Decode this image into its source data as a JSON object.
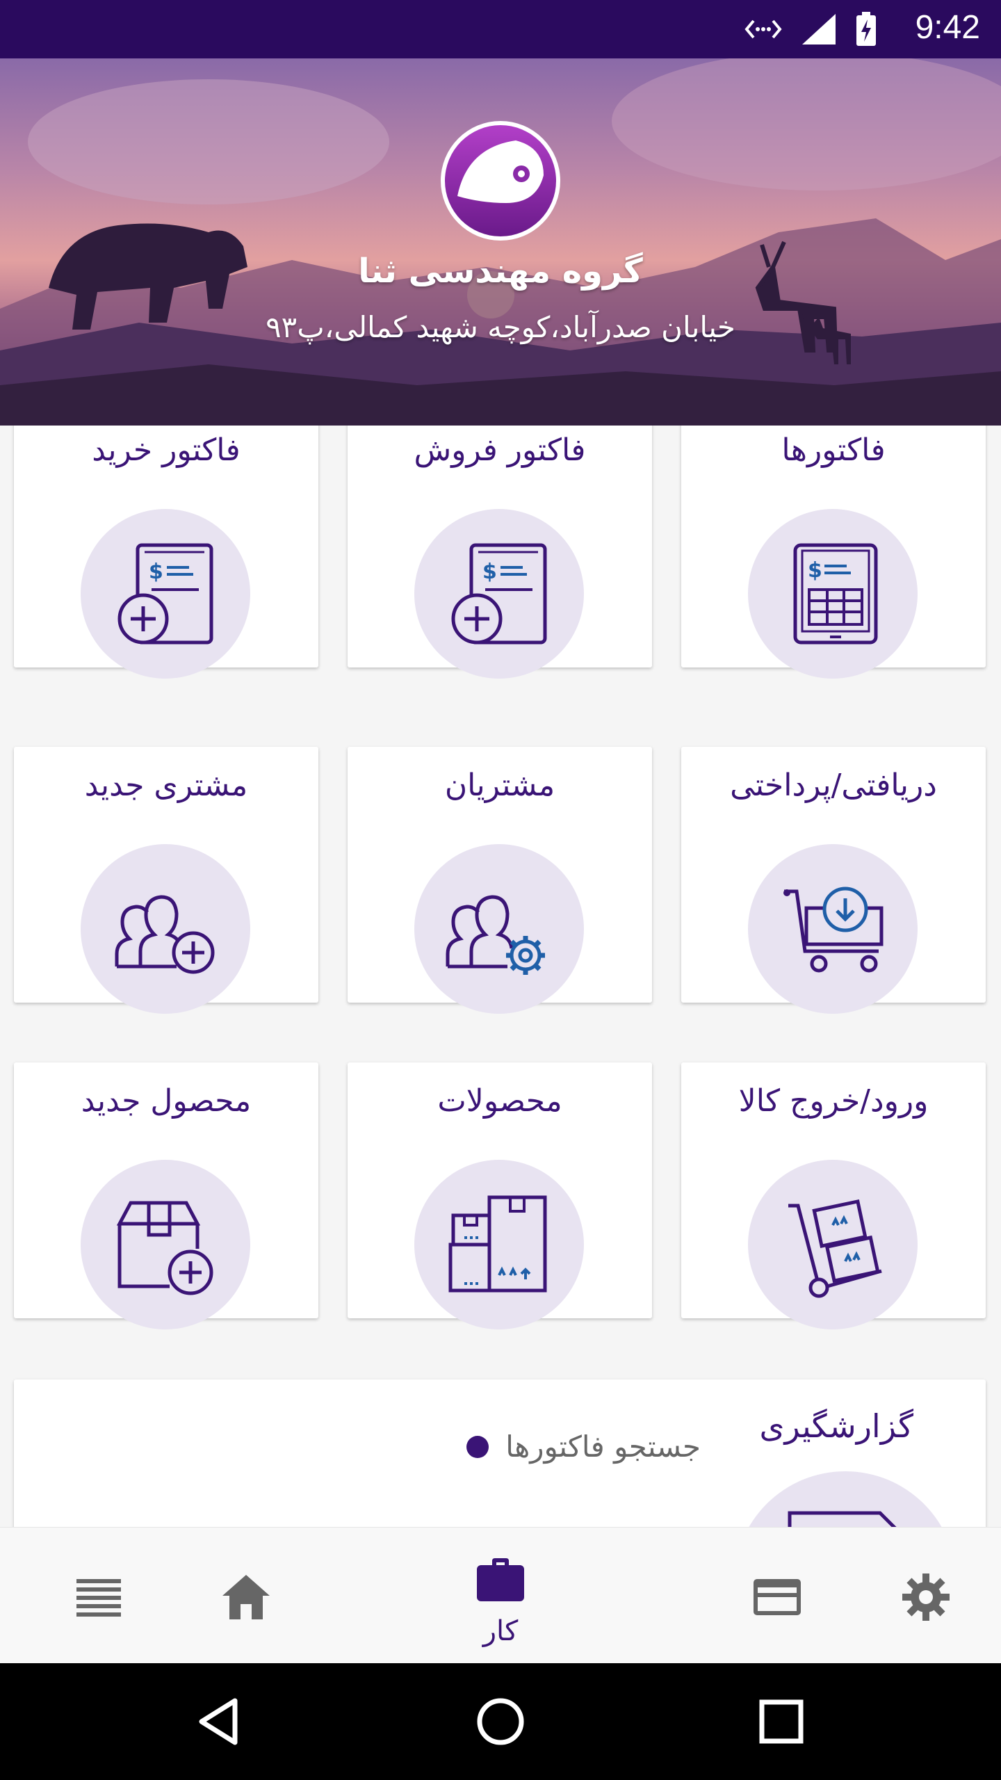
{
  "status_bar": {
    "time": "9:42"
  },
  "header": {
    "company_name": "گروه مهندسی ثنا",
    "address": "خیابان صدرآباد،کوچه شهید کمالی،پ۹۳"
  },
  "grid": {
    "items": [
      {
        "label": "فاکتورها"
      },
      {
        "label": "فاکتور فروش"
      },
      {
        "label": "فاکتور خرید"
      },
      {
        "label": "دریافتی/پرداختی"
      },
      {
        "label": "مشتریان"
      },
      {
        "label": "مشتری جدید"
      },
      {
        "label": "ورود/خروج کالا"
      },
      {
        "label": "محصولات"
      },
      {
        "label": "محصول جدید"
      }
    ]
  },
  "report": {
    "title": "گزارشگیری",
    "links": [
      "جستجو فاکتورها"
    ]
  },
  "bottom_nav": {
    "active_label": "کار",
    "items": [
      "settings-icon",
      "card-icon",
      "work-icon",
      "home-icon",
      "list-icon"
    ]
  },
  "colors": {
    "primary": "#3a1476",
    "status_bar": "#2a0a5e",
    "icon_circle": "#e8e3f1",
    "icon_accent": "#1f5fa8"
  }
}
